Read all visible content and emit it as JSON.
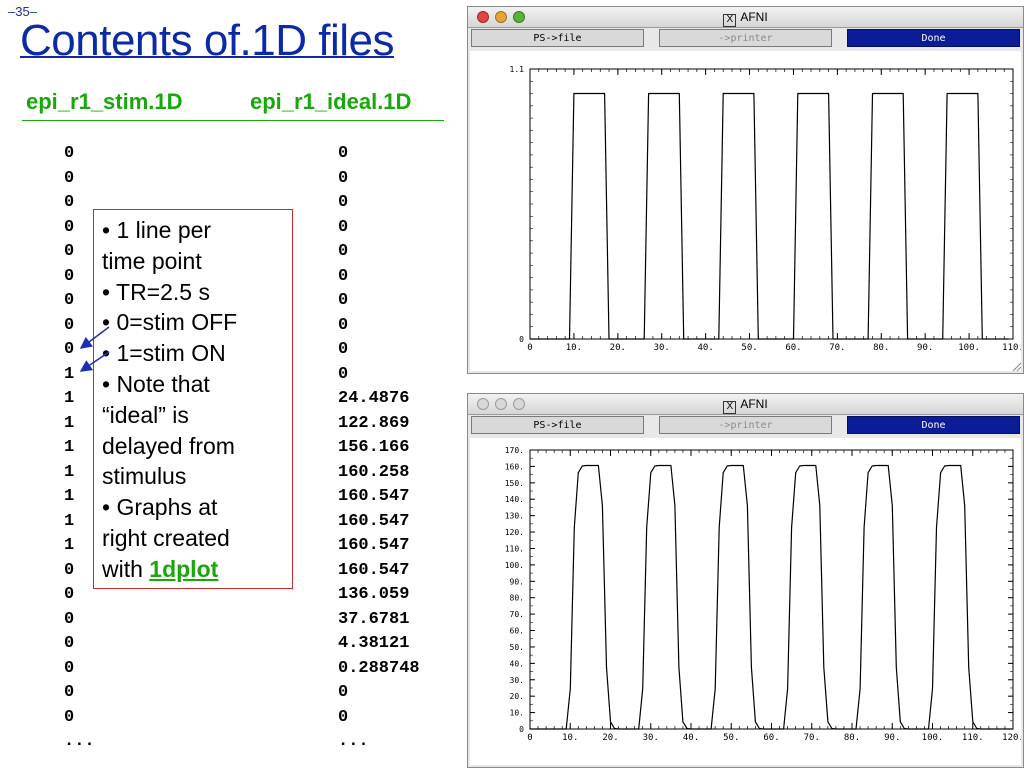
{
  "slide": {
    "number": "–35–",
    "title": "Contents of.1D files",
    "col_heads": [
      "epi_r1_stim.1D",
      "epi_r1_ideal.1D"
    ],
    "stim_values": [
      "0",
      "0",
      "0",
      "0",
      "0",
      "0",
      "0",
      "0",
      "0",
      "1",
      "1",
      "1",
      "1",
      "1",
      "1",
      "1",
      "1",
      "0",
      "0",
      "0",
      "0",
      "0",
      "0",
      "0",
      "..."
    ],
    "ideal_values": [
      "0",
      "0",
      "0",
      "0",
      "0",
      "0",
      "0",
      "0",
      "0",
      "0",
      "24.4876",
      "122.869",
      "156.166",
      "160.258",
      "160.547",
      "160.547",
      "160.547",
      "160.547",
      "136.059",
      "37.6781",
      "4.38121",
      "0.288748",
      "0",
      "0",
      "..."
    ],
    "note": {
      "lines": [
        "• 1 line per",
        "time point",
        "• TR=2.5 s",
        "• 0=stim OFF",
        "• 1=stim ON",
        "• Note that",
        "“ideal” is",
        "delayed from",
        "stimulus",
        "• Graphs at",
        "right created"
      ],
      "last_prefix": "with ",
      "link": "1dplot"
    }
  },
  "windows": [
    {
      "title": "AFNI",
      "buttons": {
        "file": "PS->file",
        "printer": "->printer",
        "done": "Done"
      },
      "chart_data": {
        "type": "line",
        "title": "",
        "xlabel": "",
        "ylabel": "",
        "xlim": [
          0,
          110
        ],
        "ylim": [
          0,
          1.1
        ],
        "x_ticks": [
          "0",
          "10.",
          "20.",
          "30.",
          "40.",
          "50.",
          "60.",
          "70.",
          "80.",
          "90.",
          "100.",
          "110."
        ],
        "y_ticks": [
          "0",
          "1.1"
        ],
        "series": [
          {
            "x": [
              0,
              9,
              10,
              17,
              18,
              26,
              27,
              34,
              35,
              43,
              44,
              51,
              52,
              60,
              61,
              68,
              69,
              77,
              78,
              85,
              86,
              94,
              95,
              102,
              103,
              109
            ],
            "y": [
              0,
              0,
              1,
              1,
              0,
              0,
              1,
              1,
              0,
              0,
              1,
              1,
              0,
              0,
              1,
              1,
              0,
              0,
              1,
              1,
              0,
              0,
              1,
              1,
              0,
              0
            ]
          }
        ]
      }
    },
    {
      "title": "AFNI",
      "buttons": {
        "file": "PS->file",
        "printer": "->printer",
        "done": "Done"
      },
      "chart_data": {
        "type": "line",
        "title": "",
        "xlabel": "",
        "ylabel": "",
        "xlim": [
          0,
          120
        ],
        "ylim": [
          0,
          170
        ],
        "x_ticks": [
          "0",
          "10.",
          "20.",
          "30.",
          "40.",
          "50.",
          "60.",
          "70.",
          "80.",
          "90.",
          "100.",
          "110.",
          "120."
        ],
        "y_ticks": [
          "0",
          "10.",
          "20.",
          "30.",
          "40.",
          "50.",
          "60.",
          "70.",
          "80.",
          "90.",
          "100.",
          "110.",
          "120.",
          "130.",
          "140.",
          "150.",
          "160.",
          "170."
        ],
        "series": [
          {
            "x": [
              0,
              9,
              10,
              11,
              12,
              13,
              14,
              15,
              16,
              17,
              18,
              19,
              20,
              21,
              22,
              27,
              28,
              29,
              30,
              31,
              32,
              33,
              34,
              35,
              36,
              37,
              38,
              39,
              40,
              45,
              46,
              47,
              48,
              49,
              50,
              51,
              52,
              53,
              54,
              55,
              56,
              57,
              58,
              63,
              64,
              65,
              66,
              67,
              68,
              69,
              70,
              71,
              72,
              73,
              74,
              75,
              76,
              81,
              82,
              83,
              84,
              85,
              86,
              87,
              88,
              89,
              90,
              91,
              92,
              93,
              94,
              99,
              100,
              101,
              102,
              103,
              104,
              105,
              106,
              107,
              108,
              109,
              110,
              111,
              112,
              120
            ],
            "y": [
              0,
              0,
              24.4876,
              122.869,
              156.166,
              160.258,
              160.547,
              160.547,
              160.547,
              160.547,
              136.059,
              37.6781,
              4.38121,
              0.288748,
              0,
              0,
              24.4876,
              122.869,
              156.166,
              160.258,
              160.547,
              160.547,
              160.547,
              160.547,
              136.059,
              37.6781,
              4.38121,
              0.288748,
              0,
              0,
              24.4876,
              122.869,
              156.166,
              160.258,
              160.547,
              160.547,
              160.547,
              160.547,
              136.059,
              37.6781,
              4.38121,
              0.288748,
              0,
              0,
              24.4876,
              122.869,
              156.166,
              160.258,
              160.547,
              160.547,
              160.547,
              160.547,
              136.059,
              37.6781,
              4.38121,
              0.288748,
              0,
              0,
              24.4876,
              122.869,
              156.166,
              160.258,
              160.547,
              160.547,
              160.547,
              160.547,
              136.059,
              37.6781,
              4.38121,
              0.288748,
              0,
              0,
              24.4876,
              122.869,
              156.166,
              160.258,
              160.547,
              160.547,
              160.547,
              160.547,
              136.059,
              37.6781,
              4.38121,
              0.288748,
              0,
              0
            ]
          }
        ]
      }
    }
  ],
  "colors": {
    "title": "#0c2aa8",
    "heading": "#18a80a",
    "note_border": "#cc2a2a",
    "arrow": "#1a2fb5",
    "done_button": "#0a1c96"
  }
}
